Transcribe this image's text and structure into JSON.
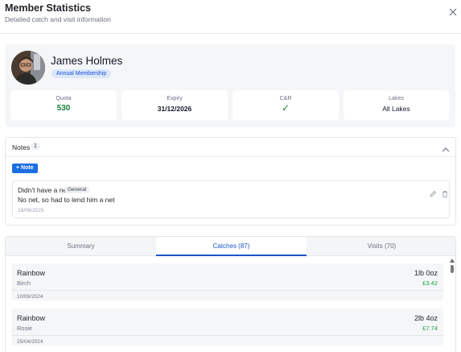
{
  "dialog": {
    "title": "Member Statistics",
    "subtitle": "Detailed catch and visit information"
  },
  "member": {
    "name": "James Holmes",
    "membership": "Annual Membership",
    "stats": [
      {
        "label": "Quota",
        "value": "530"
      },
      {
        "label": "Expiry",
        "value": "31/12/2026"
      },
      {
        "label": "C&R",
        "value": "✓"
      },
      {
        "label": "Lakes",
        "value": "All Lakes"
      }
    ]
  },
  "notes": {
    "title": "Notes",
    "count": "1",
    "add_label": "+ Note",
    "items": [
      {
        "title": "Didn't have a net",
        "category": "General",
        "body": "No net, so had to lend him a net",
        "date": "18/06/2025"
      }
    ]
  },
  "tabs": [
    {
      "label": "Summary",
      "active": false
    },
    {
      "label": "Catches (87)",
      "active": true
    },
    {
      "label": "Visits (70)",
      "active": false
    }
  ],
  "catches": [
    {
      "species": "Rainbow",
      "lake": "Birch",
      "weight": "1lb 0oz",
      "value": "£3.42",
      "date": "10/08/2024"
    },
    {
      "species": "Rainbow",
      "lake": "Rosie",
      "weight": "2lb 4oz",
      "value": "£7.74",
      "date": "25/04/2024"
    }
  ],
  "colors": {
    "accent": "#1a6fe3",
    "positive": "#15803d",
    "panel_bg": "#f5f6f8"
  },
  "icons": {
    "close": "close-icon",
    "collapse": "chevron-up-icon",
    "edit": "pencil-icon",
    "delete": "trash-icon"
  }
}
